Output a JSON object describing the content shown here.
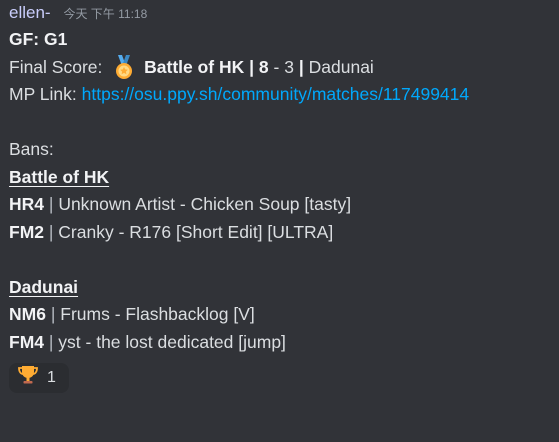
{
  "message": {
    "author": "ellen-",
    "timestamp": "今天 下午 11:18",
    "title": "GF: G1",
    "final_score": {
      "label": "Final Score:",
      "team1": "Battle of HK",
      "sep1": "|",
      "score1": "8",
      "dash": "-",
      "score2": "3",
      "sep2": "|",
      "team2": "Dadunai"
    },
    "mp_link": {
      "label": "MP Link:",
      "url": "https://osu.ppy.sh/community/matches/117499414"
    },
    "bans_label": "Bans:",
    "bans": [
      {
        "team": "Battle of HK",
        "picks": [
          {
            "slot": "HR4",
            "sep": "|",
            "map": "Unknown Artist - Chicken Soup [tasty]"
          },
          {
            "slot": "FM2",
            "sep": "|",
            "map": "Cranky - R176 [Short Edit] [ULTRA]"
          }
        ]
      },
      {
        "team": "Dadunai",
        "picks": [
          {
            "slot": "NM6",
            "sep": "|",
            "map": "Frums - Flashbacklog [V]"
          },
          {
            "slot": "FM4",
            "sep": "|",
            "map": "yst - the lost dedicated [jump]"
          }
        ]
      }
    ]
  },
  "reaction": {
    "icon": "trophy-icon",
    "count": "1"
  },
  "icons": {
    "medal": "sports-medal-icon"
  },
  "colors": {
    "background": "#313338",
    "link": "#00a8fc",
    "author": "#c9cdfb"
  }
}
